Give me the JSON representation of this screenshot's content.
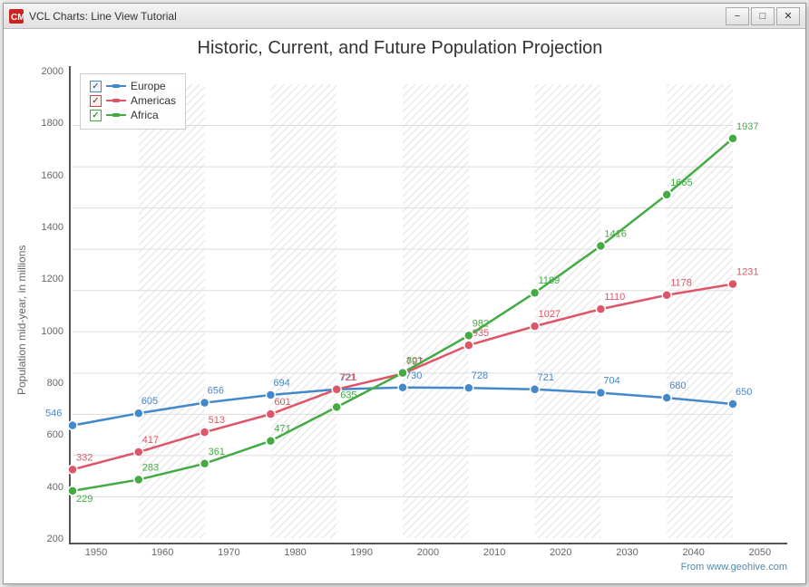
{
  "window": {
    "title": "VCL Charts: Line View Tutorial",
    "minimize_label": "−",
    "maximize_label": "□",
    "close_label": "✕"
  },
  "chart": {
    "title": "Historic, Current, and Future Population Projection",
    "y_axis_label": "Population mid-year, in millions",
    "footer": "From www.geohive.com",
    "y_ticks": [
      "2000",
      "1800",
      "1600",
      "1400",
      "1200",
      "1000",
      "800",
      "600",
      "400",
      "200"
    ],
    "x_ticks": [
      "1950",
      "1960",
      "1970",
      "1980",
      "1990",
      "2000",
      "2010",
      "2020",
      "2030",
      "2040",
      "2050"
    ],
    "legend": {
      "items": [
        {
          "label": "Europe",
          "color": "#4488cc"
        },
        {
          "label": "Americas",
          "color": "#cc4444"
        },
        {
          "label": "Africa",
          "color": "#44aa44"
        }
      ]
    },
    "series": {
      "europe": {
        "color": "#4488cc",
        "points": [
          {
            "year": 1950,
            "value": 546
          },
          {
            "year": 1960,
            "value": 605
          },
          {
            "year": 1970,
            "value": 656
          },
          {
            "year": 1980,
            "value": 694
          },
          {
            "year": 1990,
            "value": 721
          },
          {
            "year": 2000,
            "value": 730
          },
          {
            "year": 2010,
            "value": 728
          },
          {
            "year": 2020,
            "value": 721
          },
          {
            "year": 2030,
            "value": 704
          },
          {
            "year": 2040,
            "value": 680
          },
          {
            "year": 2050,
            "value": 650
          }
        ]
      },
      "americas": {
        "color": "#dd5566",
        "points": [
          {
            "year": 1950,
            "value": 332
          },
          {
            "year": 1960,
            "value": 417
          },
          {
            "year": 1970,
            "value": 513
          },
          {
            "year": 1980,
            "value": 601
          },
          {
            "year": 1990,
            "value": 721
          },
          {
            "year": 2000,
            "value": 797
          },
          {
            "year": 2010,
            "value": 935
          },
          {
            "year": 2020,
            "value": 1027
          },
          {
            "year": 2030,
            "value": 1110
          },
          {
            "year": 2040,
            "value": 1178
          },
          {
            "year": 2050,
            "value": 1231
          }
        ]
      },
      "africa": {
        "color": "#44aa44",
        "points": [
          {
            "year": 1950,
            "value": 229
          },
          {
            "year": 1960,
            "value": 283
          },
          {
            "year": 1970,
            "value": 361
          },
          {
            "year": 1980,
            "value": 471
          },
          {
            "year": 1990,
            "value": 635
          },
          {
            "year": 2000,
            "value": 801
          },
          {
            "year": 2010,
            "value": 982
          },
          {
            "year": 2020,
            "value": 1189
          },
          {
            "year": 2030,
            "value": 1416
          },
          {
            "year": 2040,
            "value": 1665
          },
          {
            "year": 2050,
            "value": 1937
          }
        ]
      }
    },
    "shaded_years": [
      1960,
      1980,
      2000,
      2020,
      2040
    ],
    "future_start": 2010
  }
}
